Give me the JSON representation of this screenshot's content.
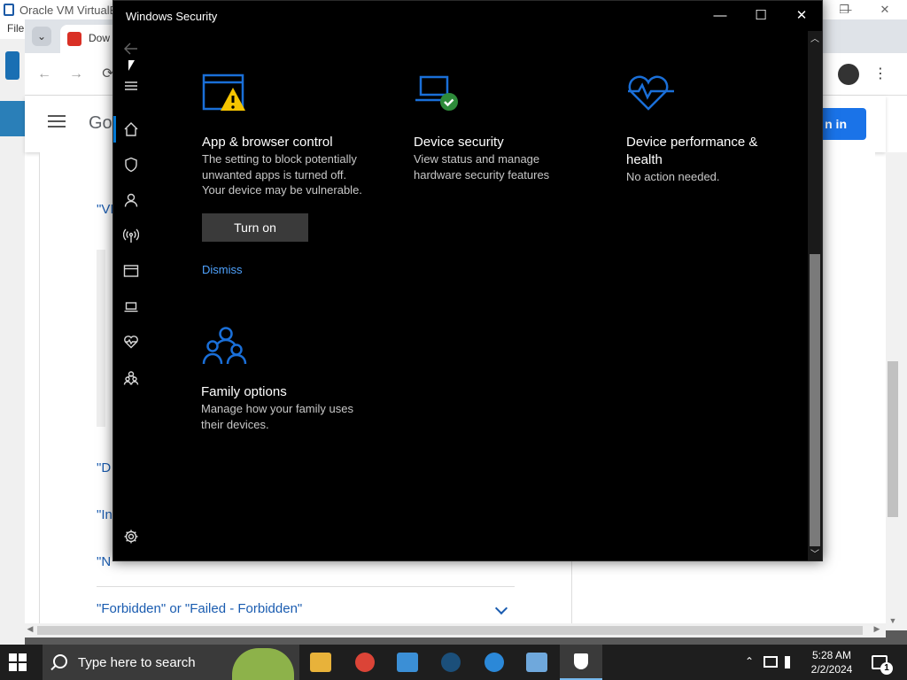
{
  "host": {
    "title": "Oracle VM VirtualBox",
    "menu_file": "File",
    "window_controls": [
      "—",
      "❐",
      "✕"
    ]
  },
  "browser": {
    "tab_title": "Dow",
    "tab_dropdown": "⌄",
    "nav_back": "←",
    "nav_forward": "→",
    "nav_reload": "⟳",
    "logo_text": "Goo",
    "signin_label": "n in",
    "kebab": "⋮",
    "faq_items": [
      "\"VI",
      "\"D",
      "\"In",
      "\"N",
      "\"Forbidden\" or \"Failed - Forbidden\""
    ]
  },
  "security_window": {
    "title": "Windows Security",
    "controls": {
      "minimize": "—",
      "maximize": "☐",
      "close": "✕"
    },
    "back_arrow": "←",
    "nav_items": [
      {
        "icon": "home-icon"
      },
      {
        "icon": "shield-icon"
      },
      {
        "icon": "account-icon"
      },
      {
        "icon": "firewall-network-icon"
      },
      {
        "icon": "app-browser-icon"
      },
      {
        "icon": "device-security-icon"
      },
      {
        "icon": "device-health-icon"
      },
      {
        "icon": "family-icon"
      },
      {
        "icon": "settings-gear-icon"
      }
    ],
    "cards": [
      {
        "id": "app-browser",
        "icon": "app-browser-warning-icon",
        "title": "App & browser control",
        "description": "The setting to block potentially unwanted apps is turned off. Your device may be vulnerable.",
        "action_button": "Turn on",
        "action_link": "Dismiss"
      },
      {
        "id": "device-security",
        "icon": "laptop-check-icon",
        "title": "Device security",
        "description": "View status and manage hardware security features"
      },
      {
        "id": "device-performance",
        "icon": "heart-pulse-icon",
        "title": "Device performance & health",
        "description": "No action needed."
      },
      {
        "id": "family",
        "icon": "family-group-icon",
        "title": "Family options",
        "description": "Manage how your family uses their devices."
      }
    ]
  },
  "taskbar": {
    "search_placeholder": "Type here to search",
    "apps": [
      {
        "icon": "file-explorer-icon"
      },
      {
        "icon": "chrome-icon"
      },
      {
        "icon": "app-icon"
      },
      {
        "icon": "steam-icon"
      },
      {
        "icon": "feedback-hub-icon"
      },
      {
        "icon": "virtualbox-icon"
      },
      {
        "icon": "windows-security-icon"
      }
    ],
    "tray_chevron": "⌃",
    "time": "5:28 AM",
    "date": "2/2/2024",
    "notification_count": "1"
  },
  "colors": {
    "accent_blue": "#0078d4",
    "warning_yellow": "#f5c400",
    "ok_green": "#2e8b3a",
    "link_blue": "#4fa3ff"
  }
}
